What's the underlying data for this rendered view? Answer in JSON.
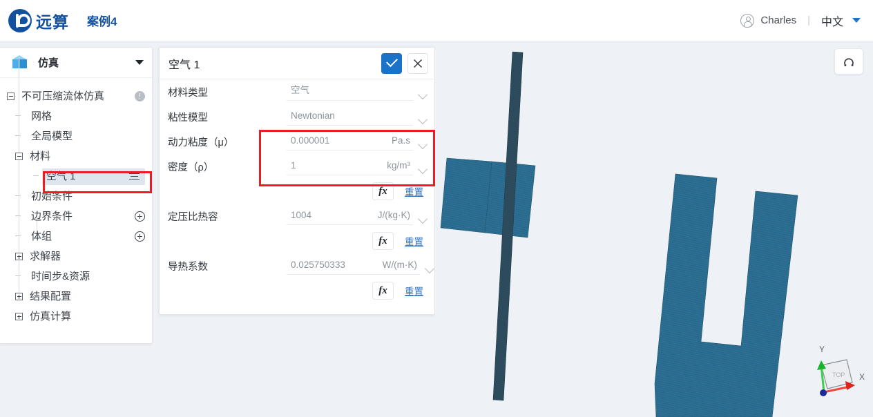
{
  "topbar": {
    "brand": "远算",
    "case_name": "案例4",
    "user": "Charles",
    "separator": "|",
    "language": "中文",
    "icons": {
      "user": "user-avatar-icon",
      "caret": "chevron-down-icon"
    }
  },
  "sidebar": {
    "header_title": "仿真",
    "header_icon": "cube-icon",
    "tree": [
      {
        "label": "不可压缩流体仿真",
        "level": 0,
        "toggle": "minus",
        "trailing": "warning",
        "selected": false
      },
      {
        "label": "网格",
        "level": 1,
        "toggle": "stub",
        "trailing": "none",
        "selected": false
      },
      {
        "label": "全局模型",
        "level": 1,
        "toggle": "stub",
        "trailing": "none",
        "selected": false
      },
      {
        "label": "材料",
        "level": 1,
        "toggle": "minus",
        "trailing": "none",
        "selected": false
      },
      {
        "label": "空气 1",
        "level": 2,
        "toggle": "stub",
        "trailing": "menu",
        "selected": true
      },
      {
        "label": "初始条件",
        "level": 1,
        "toggle": "stub",
        "trailing": "none",
        "selected": false
      },
      {
        "label": "边界条件",
        "level": 1,
        "toggle": "stub",
        "trailing": "plus",
        "selected": false
      },
      {
        "label": "体组",
        "level": 1,
        "toggle": "stub",
        "trailing": "plus",
        "selected": false
      },
      {
        "label": "求解器",
        "level": 1,
        "toggle": "plus",
        "trailing": "none",
        "selected": false
      },
      {
        "label": "时间步&资源",
        "level": 1,
        "toggle": "stub",
        "trailing": "none",
        "selected": false
      },
      {
        "label": "结果配置",
        "level": 1,
        "toggle": "plus",
        "trailing": "none",
        "selected": false
      },
      {
        "label": "仿真计算",
        "level": 1,
        "toggle": "plus",
        "trailing": "none",
        "selected": false
      }
    ]
  },
  "panel": {
    "title": "空气 1",
    "confirm_icon": "check-icon",
    "cancel_icon": "close-icon",
    "fields": [
      {
        "label": "材料类型",
        "value": "空气",
        "unit": "",
        "fx": false
      },
      {
        "label": "粘性模型",
        "value": "Newtonian",
        "unit": "",
        "fx": false
      },
      {
        "label": "动力粘度（μ）",
        "value": "0.000001",
        "unit": "Pa.s",
        "fx": false
      },
      {
        "label": "密度（ρ）",
        "value": "1",
        "unit": "kg/m³",
        "fx": true
      },
      {
        "label": "定压比热容",
        "value": "1004",
        "unit": "J/(kg·K)",
        "fx": true
      },
      {
        "label": "导热系数",
        "value": "0.025750333",
        "unit": "W/(m·K)",
        "fx": true
      }
    ],
    "fx_label": "fx",
    "reset_label": "重置"
  },
  "viewport": {
    "reset_view_icon": "reset-rotate-icon",
    "axis_gizmo": {
      "x_label": "X",
      "y_label": "Y",
      "face_label": "TOP"
    },
    "mesh_color": "#2d7096",
    "background": "#eef1f5"
  },
  "annotations": {
    "tree_highlight_color": "#ed1c24",
    "panel_highlight_color": "#ed1c24"
  }
}
